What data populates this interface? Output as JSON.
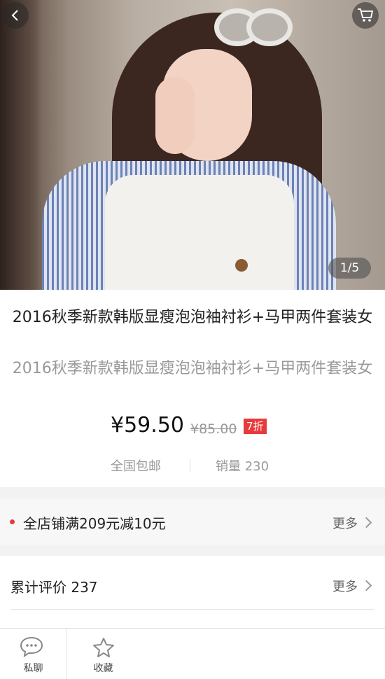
{
  "gallery": {
    "pager": "1/5"
  },
  "product": {
    "title": "2016秋季新款韩版显瘦泡泡袖衬衫+马甲两件套装女",
    "subtitle": "2016秋季新款韩版显瘦泡泡袖衬衫+马甲两件套装女",
    "price": "¥59.50",
    "original_price": "¥85.00",
    "discount": "7折",
    "shipping": "全国包邮",
    "sales": "销量 230"
  },
  "promo": {
    "text": "全店铺满209元减10元",
    "more": "更多"
  },
  "reviews": {
    "label": "累计评价 237",
    "more": "更多"
  },
  "bottom_bar": {
    "chat_label": "私聊",
    "favorite_label": "收藏"
  },
  "colors": {
    "accent": "#e8393c"
  }
}
